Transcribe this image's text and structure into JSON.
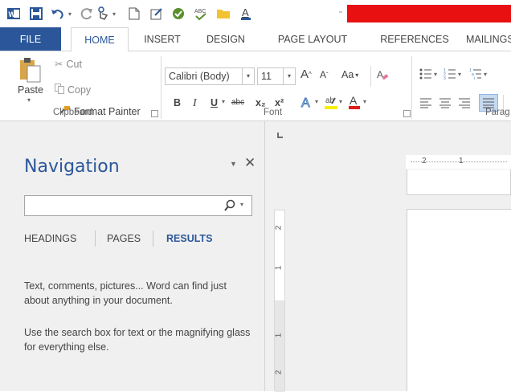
{
  "qat": {
    "icons": [
      "word-logo-icon",
      "save-icon",
      "undo-icon",
      "redo-icon",
      "touch-mode-icon",
      "new-document-icon",
      "edit-icon",
      "proofing-icon",
      "spelling-check-icon",
      "open-folder-icon",
      "font-color-icon"
    ],
    "undo_caret": "▾",
    "redo_caret": "▾"
  },
  "tabs": [
    "FILE",
    "HOME",
    "INSERT",
    "DESIGN",
    "PAGE LAYOUT",
    "REFERENCES",
    "MAILINGS"
  ],
  "ribbon": {
    "clipboard": {
      "paste": "Paste",
      "cut": "Cut",
      "copy": "Copy",
      "format_painter": "Format Painter",
      "group_label": "Clipboard"
    },
    "font": {
      "font_name": "Calibri (Body)",
      "font_size": "11",
      "bold": "B",
      "italic": "I",
      "underline": "U",
      "strikethrough": "abc",
      "subscript": "x₂",
      "superscript": "x²",
      "change_case": "Aa",
      "group_label": "Font"
    },
    "paragraph": {
      "group_label": "Parag"
    }
  },
  "navigation": {
    "title": "Navigation",
    "search_placeholder": "",
    "tabs": [
      "HEADINGS",
      "PAGES",
      "RESULTS"
    ],
    "active_tab": "RESULTS",
    "message_1": "Text, comments, pictures... Word can find just about anything in your document.",
    "message_2": "Use the search box for text or the magnifying glass for everything else."
  },
  "ruler": {
    "horizontal_labels": [
      "2",
      "1"
    ],
    "vertical_labels": [
      "2",
      "1",
      "1",
      "2"
    ]
  },
  "colors": {
    "accent": "#2b579a",
    "redacted": "#e81010",
    "pane_bg": "#f0f0f0"
  }
}
